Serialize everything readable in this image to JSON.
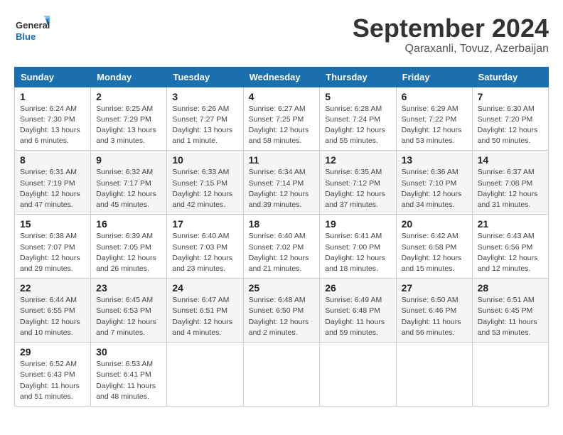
{
  "header": {
    "logo_general": "General",
    "logo_blue": "Blue",
    "month": "September 2024",
    "location": "Qaraxanli, Tovuz, Azerbaijan"
  },
  "weekdays": [
    "Sunday",
    "Monday",
    "Tuesday",
    "Wednesday",
    "Thursday",
    "Friday",
    "Saturday"
  ],
  "weeks": [
    [
      {
        "day": "1",
        "sunrise": "6:24 AM",
        "sunset": "7:30 PM",
        "daylight": "13 hours and 6 minutes."
      },
      {
        "day": "2",
        "sunrise": "6:25 AM",
        "sunset": "7:29 PM",
        "daylight": "13 hours and 3 minutes."
      },
      {
        "day": "3",
        "sunrise": "6:26 AM",
        "sunset": "7:27 PM",
        "daylight": "13 hours and 1 minute."
      },
      {
        "day": "4",
        "sunrise": "6:27 AM",
        "sunset": "7:25 PM",
        "daylight": "12 hours and 58 minutes."
      },
      {
        "day": "5",
        "sunrise": "6:28 AM",
        "sunset": "7:24 PM",
        "daylight": "12 hours and 55 minutes."
      },
      {
        "day": "6",
        "sunrise": "6:29 AM",
        "sunset": "7:22 PM",
        "daylight": "12 hours and 53 minutes."
      },
      {
        "day": "7",
        "sunrise": "6:30 AM",
        "sunset": "7:20 PM",
        "daylight": "12 hours and 50 minutes."
      }
    ],
    [
      {
        "day": "8",
        "sunrise": "6:31 AM",
        "sunset": "7:19 PM",
        "daylight": "12 hours and 47 minutes."
      },
      {
        "day": "9",
        "sunrise": "6:32 AM",
        "sunset": "7:17 PM",
        "daylight": "12 hours and 45 minutes."
      },
      {
        "day": "10",
        "sunrise": "6:33 AM",
        "sunset": "7:15 PM",
        "daylight": "12 hours and 42 minutes."
      },
      {
        "day": "11",
        "sunrise": "6:34 AM",
        "sunset": "7:14 PM",
        "daylight": "12 hours and 39 minutes."
      },
      {
        "day": "12",
        "sunrise": "6:35 AM",
        "sunset": "7:12 PM",
        "daylight": "12 hours and 37 minutes."
      },
      {
        "day": "13",
        "sunrise": "6:36 AM",
        "sunset": "7:10 PM",
        "daylight": "12 hours and 34 minutes."
      },
      {
        "day": "14",
        "sunrise": "6:37 AM",
        "sunset": "7:08 PM",
        "daylight": "12 hours and 31 minutes."
      }
    ],
    [
      {
        "day": "15",
        "sunrise": "6:38 AM",
        "sunset": "7:07 PM",
        "daylight": "12 hours and 29 minutes."
      },
      {
        "day": "16",
        "sunrise": "6:39 AM",
        "sunset": "7:05 PM",
        "daylight": "12 hours and 26 minutes."
      },
      {
        "day": "17",
        "sunrise": "6:40 AM",
        "sunset": "7:03 PM",
        "daylight": "12 hours and 23 minutes."
      },
      {
        "day": "18",
        "sunrise": "6:40 AM",
        "sunset": "7:02 PM",
        "daylight": "12 hours and 21 minutes."
      },
      {
        "day": "19",
        "sunrise": "6:41 AM",
        "sunset": "7:00 PM",
        "daylight": "12 hours and 18 minutes."
      },
      {
        "day": "20",
        "sunrise": "6:42 AM",
        "sunset": "6:58 PM",
        "daylight": "12 hours and 15 minutes."
      },
      {
        "day": "21",
        "sunrise": "6:43 AM",
        "sunset": "6:56 PM",
        "daylight": "12 hours and 12 minutes."
      }
    ],
    [
      {
        "day": "22",
        "sunrise": "6:44 AM",
        "sunset": "6:55 PM",
        "daylight": "12 hours and 10 minutes."
      },
      {
        "day": "23",
        "sunrise": "6:45 AM",
        "sunset": "6:53 PM",
        "daylight": "12 hours and 7 minutes."
      },
      {
        "day": "24",
        "sunrise": "6:47 AM",
        "sunset": "6:51 PM",
        "daylight": "12 hours and 4 minutes."
      },
      {
        "day": "25",
        "sunrise": "6:48 AM",
        "sunset": "6:50 PM",
        "daylight": "12 hours and 2 minutes."
      },
      {
        "day": "26",
        "sunrise": "6:49 AM",
        "sunset": "6:48 PM",
        "daylight": "11 hours and 59 minutes."
      },
      {
        "day": "27",
        "sunrise": "6:50 AM",
        "sunset": "6:46 PM",
        "daylight": "11 hours and 56 minutes."
      },
      {
        "day": "28",
        "sunrise": "6:51 AM",
        "sunset": "6:45 PM",
        "daylight": "11 hours and 53 minutes."
      }
    ],
    [
      {
        "day": "29",
        "sunrise": "6:52 AM",
        "sunset": "6:43 PM",
        "daylight": "11 hours and 51 minutes."
      },
      {
        "day": "30",
        "sunrise": "6:53 AM",
        "sunset": "6:41 PM",
        "daylight": "11 hours and 48 minutes."
      },
      null,
      null,
      null,
      null,
      null
    ]
  ]
}
